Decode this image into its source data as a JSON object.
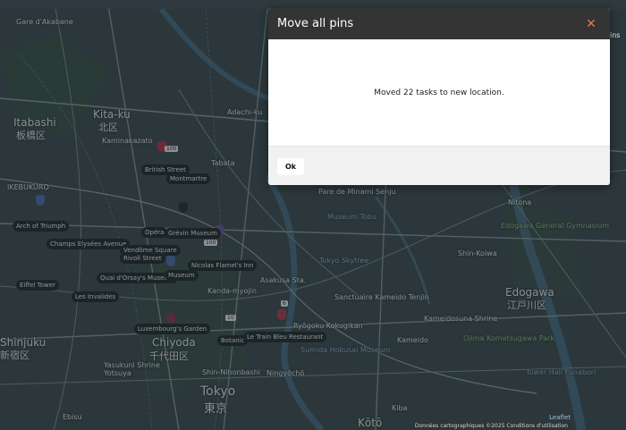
{
  "modal": {
    "title": "Move all pins",
    "close_icon": "close-icon",
    "message": "Moved 22 tasks to new location.",
    "ok_label": "Ok",
    "accent_color": "#e8754e",
    "header_color": "#343434"
  },
  "map": {
    "districts": [
      {
        "id": "kita",
        "text": "Kita-ku"
      },
      {
        "id": "kita_jp",
        "text": "北区"
      },
      {
        "id": "itabashi",
        "text": "Itabashi"
      },
      {
        "id": "itabashi_jp",
        "text": "板橋区"
      },
      {
        "id": "chiyoda",
        "text": "Chiyoda"
      },
      {
        "id": "chiyoda_jp",
        "text": "千代田区"
      },
      {
        "id": "tokyo",
        "text": "Tokyo"
      },
      {
        "id": "tokyo_jp",
        "text": "東京"
      },
      {
        "id": "edogawa",
        "text": "Edogawa"
      },
      {
        "id": "edogawa_jp",
        "text": "江戸川区"
      },
      {
        "id": "shinjuku",
        "text": "Shinjuku"
      },
      {
        "id": "shinjuku_jp",
        "text": "新宿区"
      },
      {
        "id": "koto",
        "text": "Kōtō"
      }
    ],
    "places": [
      {
        "id": "gare",
        "text": "Gare d'Akabane"
      },
      {
        "id": "adachi",
        "text": "Adachi-ku"
      },
      {
        "id": "kamikasa",
        "text": "Kaminakazato"
      },
      {
        "id": "tabata",
        "text": "Tabata"
      },
      {
        "id": "ikebukuro",
        "text": "IKEBUKURO"
      },
      {
        "id": "minami",
        "text": "Pare de Minami Senju"
      },
      {
        "id": "nitona",
        "text": "Nitona"
      },
      {
        "id": "gym",
        "text": "Edogawa General Gymnasium"
      },
      {
        "id": "shinkoiwa",
        "text": "Shin-Koiwa"
      },
      {
        "id": "museum",
        "text": "Museum Tobu"
      },
      {
        "id": "skytree",
        "text": "Tokyo Skytree"
      },
      {
        "id": "asakusa",
        "text": "Asakusa Sta."
      },
      {
        "id": "sanctuaire",
        "text": "Sanctuaire Kameido Tenjin"
      },
      {
        "id": "kameido",
        "text": "Kameidosuna Shrine"
      },
      {
        "id": "kameido_st",
        "text": "Kameido"
      },
      {
        "id": "ojima",
        "text": "Ojima Komatsugawa Park"
      },
      {
        "id": "towerhall",
        "text": "Tower Hall Funabori"
      },
      {
        "id": "sumida",
        "text": "Sumida Hokusai Museum"
      },
      {
        "id": "ningyocho",
        "text": "Ningyōchō"
      },
      {
        "id": "nihonbashi",
        "text": "Shin-Nihonbashi"
      },
      {
        "id": "yotsuya",
        "text": "Yotsuya"
      },
      {
        "id": "kanda",
        "text": "Kanda-myojin"
      },
      {
        "id": "yasukuni",
        "text": "Yasukuni Shrine"
      },
      {
        "id": "kokugikan",
        "text": "Ryōgoku Kokugikan"
      },
      {
        "id": "kiba",
        "text": "Kiba"
      },
      {
        "id": "ebisu",
        "text": "Ebisu"
      }
    ],
    "pins": [
      {
        "id": "british",
        "text": "British Street"
      },
      {
        "id": "montmartre",
        "text": "Montmartre"
      },
      {
        "id": "arch",
        "text": "Arch of Triumph"
      },
      {
        "id": "champs",
        "text": "Champs Elysées Avenue"
      },
      {
        "id": "vendome",
        "text": "Vendôme Square"
      },
      {
        "id": "rivoli",
        "text": "Rivoli Street"
      },
      {
        "id": "opera",
        "text": "Opéra"
      },
      {
        "id": "grevin",
        "text": "Grévin Museum"
      },
      {
        "id": "flamel",
        "text": "Nicolas Flamel's Inn"
      },
      {
        "id": "eiffel",
        "text": "Eiffel Tower"
      },
      {
        "id": "orsay",
        "text": "Quai d'Orsay's Museum"
      },
      {
        "id": "invalides",
        "text": "Les Invalides"
      },
      {
        "id": "luxembourg",
        "text": "Luxembourg's Garden"
      },
      {
        "id": "botanic",
        "text": "Botanic"
      },
      {
        "id": "traincafe",
        "text": "Le Train Bleu Restaurant"
      },
      {
        "id": "musee",
        "text": "Museum"
      }
    ],
    "attribution": "Données cartographiques ©2025   Conditions d'utilisation",
    "leaflet": "Leaflet",
    "side_fragment": "ins"
  }
}
